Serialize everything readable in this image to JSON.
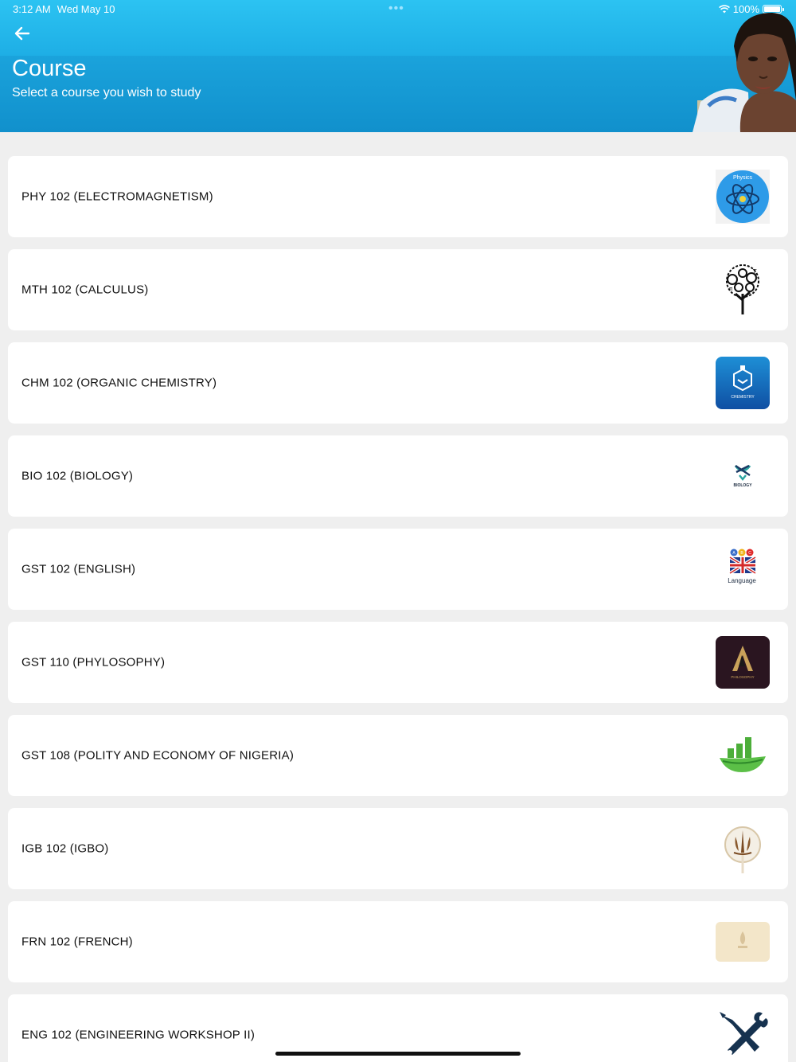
{
  "status_bar": {
    "time": "3:12 AM",
    "date": "Wed May 10",
    "battery": "100%"
  },
  "header": {
    "title": "Course",
    "subtitle": "Select a course you wish to study"
  },
  "courses": [
    {
      "label": "PHY 102 (ELECTROMAGNETISM)",
      "icon": "physics-atom-icon",
      "icon_text": "Physics"
    },
    {
      "label": "MTH 102 (CALCULUS)",
      "icon": "math-tree-icon"
    },
    {
      "label": "CHM 102 (ORGANIC CHEMISTRY)",
      "icon": "chemistry-flask-icon",
      "icon_text": "CHEMISTRY"
    },
    {
      "label": "BIO 102 (BIOLOGY)",
      "icon": "biology-dna-icon",
      "icon_text": "BIOLOGY"
    },
    {
      "label": "GST 102 (ENGLISH)",
      "icon": "language-flag-icon",
      "icon_text": "Language"
    },
    {
      "label": "GST 110 (PHYLOSOPHY)",
      "icon": "philosophy-icon",
      "icon_text": "PHILOSOPHY"
    },
    {
      "label": "GST 108 (POLITY AND ECONOMY OF NIGERIA)",
      "icon": "economy-chart-icon"
    },
    {
      "label": "IGB 102 (IGBO)",
      "icon": "igbo-emblem-icon"
    },
    {
      "label": "FRN 102 (FRENCH)",
      "icon": "french-emblem-icon"
    },
    {
      "label": "ENG 102 (ENGINEERING WORKSHOP II)",
      "icon": "tools-wrench-icon"
    }
  ],
  "colors": {
    "header": "#1aa2db",
    "background": "#efefef",
    "card": "#ffffff"
  }
}
